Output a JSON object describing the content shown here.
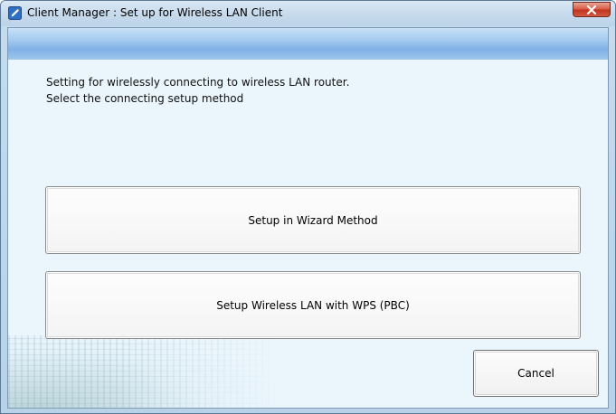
{
  "window": {
    "title": "Client Manager : Set up for Wireless LAN Client",
    "app_icon": "client-manager-pencil-icon",
    "close_icon": "close-icon"
  },
  "description": {
    "line1": "Setting for wirelessly connecting to wireless LAN router.",
    "line2": "Select the connecting setup method"
  },
  "buttons": {
    "wizard_label": "Setup in Wizard Method",
    "wps_label": "Setup Wireless LAN with WPS (PBC)",
    "cancel_label": "Cancel"
  },
  "colors": {
    "close_button_red": "#c2351f",
    "banner_blue": "#7fb1e6",
    "client_background": "#eaf5fc"
  }
}
